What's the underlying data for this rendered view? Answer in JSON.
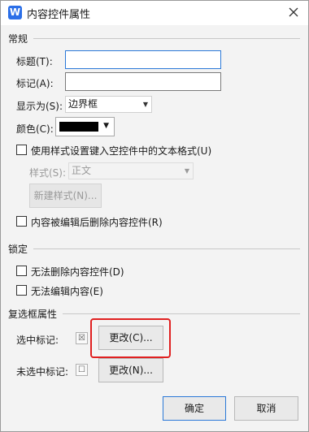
{
  "title_bar": {
    "title": "内容控件属性",
    "app_icon_letter": "W"
  },
  "general": {
    "header": "常规",
    "title_label": "标题(T):",
    "title_value": "",
    "tag_label": "标记(A):",
    "tag_value": "",
    "show_as_label": "显示为(S):",
    "show_as_value": "边界框",
    "color_label": "颜色(C):",
    "color_value": "#000000",
    "use_style_label": "使用样式设置键入空控件中的文本格式(U)",
    "use_style_checked": false,
    "style_label": "样式(S):",
    "style_value": "正文",
    "new_style_button": "新建样式(N)...",
    "remove_on_edit_label": "内容被编辑后删除内容控件(R)",
    "remove_on_edit_checked": false
  },
  "locking": {
    "header": "锁定",
    "no_delete_label": "无法删除内容控件(D)",
    "no_delete_checked": false,
    "no_edit_label": "无法编辑内容(E)",
    "no_edit_checked": false
  },
  "checkbox_props": {
    "header": "复选框属性",
    "checked_label": "选中标记:",
    "checked_symbol": "☒",
    "checked_change_button": "更改(C)...",
    "unchecked_label": "未选中标记:",
    "unchecked_symbol": "☐",
    "unchecked_change_button": "更改(N)..."
  },
  "footer": {
    "ok_button": "确定",
    "cancel_button": "取消"
  },
  "colors": {
    "accent": "#2b79d8",
    "highlight": "#e02020"
  }
}
